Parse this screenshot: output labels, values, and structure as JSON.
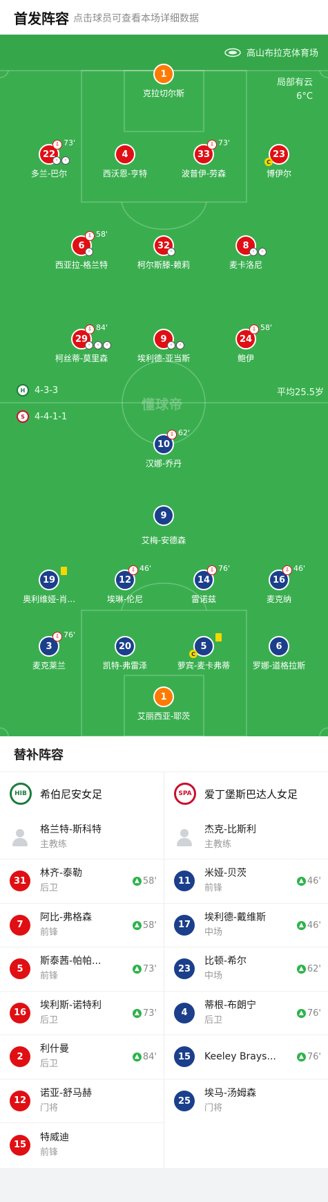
{
  "header": {
    "title": "首发阵容",
    "hint": "点击球员可查看本场详细数据"
  },
  "pitch": {
    "stadium": "高山布拉克体育场",
    "weather": "局部有云",
    "temperature": "6°C",
    "watermark": "懂球帝",
    "home_formation": "4-3-3",
    "away_formation": "4-4-1-1",
    "avg_age": "平均25.5岁"
  },
  "home_lineup": [
    {
      "number": "1",
      "name": "克拉切尔斯"
    },
    {
      "number": "22",
      "name": "多兰-巴尔",
      "sub_min": "73'",
      "balls": 2
    },
    {
      "number": "4",
      "name": "西沃恩-亨特"
    },
    {
      "number": "33",
      "name": "波普伊-劳森",
      "sub_min": "73'"
    },
    {
      "number": "23",
      "name": "博伊尔",
      "captain": "C"
    },
    {
      "number": "6",
      "name": "西亚拉-格兰特",
      "sub_min": "58'",
      "balls": 1
    },
    {
      "number": "32",
      "name": "柯尔斯滕-赖莉",
      "balls": 1
    },
    {
      "number": "8",
      "name": "麦卡洛尼",
      "balls": 2
    },
    {
      "number": "29",
      "name": "柯丝蒂-莫里森",
      "sub_min": "84'",
      "balls": 3
    },
    {
      "number": "9",
      "name": "埃利德-亚当斯",
      "balls": 2
    },
    {
      "number": "24",
      "name": "鲍伊",
      "sub_min": "58'"
    }
  ],
  "away_lineup": [
    {
      "number": "10",
      "name": "汉娜-乔丹",
      "sub_min": "62'"
    },
    {
      "number": "9",
      "name": "艾梅-安德森"
    },
    {
      "number": "19",
      "name": "奥利维娅-肖..."
    },
    {
      "number": "12",
      "name": "埃琳-伦尼",
      "sub_min": "46'"
    },
    {
      "number": "14",
      "name": "雷诺兹",
      "sub_min": "76'"
    },
    {
      "number": "16",
      "name": "麦克纳",
      "sub_min": "46'"
    },
    {
      "number": "3",
      "name": "麦克莱兰",
      "sub_min": "76'"
    },
    {
      "number": "20",
      "name": "凯特-弗雷泽"
    },
    {
      "number": "5",
      "name": "萝宾-麦卡弗蒂",
      "captain": "C"
    },
    {
      "number": "6",
      "name": "罗娜-道格拉斯"
    },
    {
      "number": "1",
      "name": "艾丽西亚-耶茨"
    }
  ],
  "subs": {
    "title": "替补阵容",
    "home": {
      "team": "希伯尼安女足",
      "crest_text": "HIB",
      "coach": {
        "name": "格兰特-斯科特",
        "role": "主教练"
      },
      "players": [
        {
          "number": "31",
          "name": "林齐-泰勒",
          "position": "后卫",
          "in_min": "58'"
        },
        {
          "number": "7",
          "name": "阿比-弗格森",
          "position": "前锋",
          "in_min": "58'"
        },
        {
          "number": "5",
          "name": "斯泰茜-帕帕...",
          "position": "前锋",
          "in_min": "73'"
        },
        {
          "number": "16",
          "name": "埃利斯-诺特利",
          "position": "后卫",
          "in_min": "73'"
        },
        {
          "number": "2",
          "name": "利什曼",
          "position": "后卫",
          "in_min": "84'"
        },
        {
          "number": "12",
          "name": "诺亚-舒马赫",
          "position": "门将",
          "in_min": ""
        },
        {
          "number": "15",
          "name": "特威迪",
          "position": "前锋",
          "in_min": ""
        }
      ]
    },
    "away": {
      "team": "爱丁堡斯巴达人女足",
      "crest_text": "SPA",
      "coach": {
        "name": "杰克-比斯利",
        "role": "主教练"
      },
      "players": [
        {
          "number": "11",
          "name": "米娅-贝茨",
          "position": "前锋",
          "in_min": "46'"
        },
        {
          "number": "17",
          "name": "埃利德-戴维斯",
          "position": "中场",
          "in_min": "46'"
        },
        {
          "number": "23",
          "name": "比顿-希尔",
          "position": "中场",
          "in_min": "62'"
        },
        {
          "number": "4",
          "name": "蒂根-布朗宁",
          "position": "后卫",
          "in_min": "76'"
        },
        {
          "number": "15",
          "name": "Keeley Brays...",
          "position": "",
          "in_min": "76'"
        },
        {
          "number": "25",
          "name": "埃马-汤姆森",
          "position": "门将",
          "in_min": ""
        }
      ]
    }
  },
  "colors": {
    "home": "#e00f14",
    "away": "#1b3f8b",
    "goalkeeper": "#ff7a00",
    "pitch": "#3aae4f",
    "sub_in": "#2cb34a"
  }
}
